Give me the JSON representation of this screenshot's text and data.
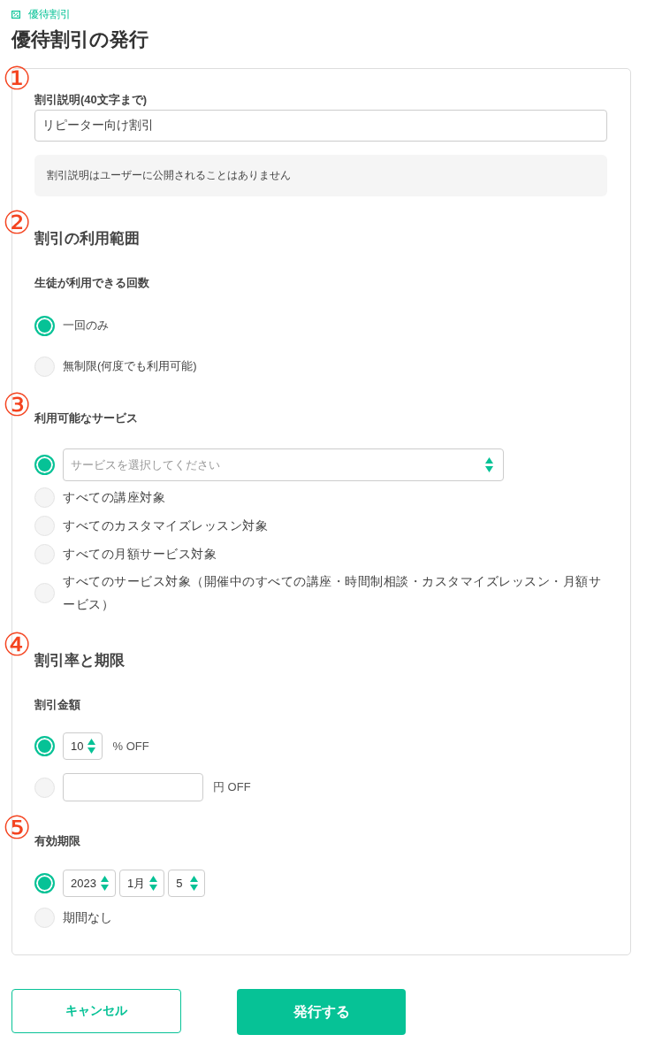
{
  "breadcrumb": {
    "label": "優待割引"
  },
  "title": "優待割引の発行",
  "form": {
    "blocks": [
      {
        "kind": "text_field",
        "marker": "①",
        "label": "割引説明(40文字まで)",
        "value": "リピーター向け割引",
        "note": "割引説明はユーザーに公開されることはありません"
      },
      {
        "kind": "heading",
        "marker": "②",
        "text": "割引の利用範囲"
      },
      {
        "kind": "radio_group",
        "label": "生徒が利用できる回数",
        "options": [
          {
            "kind": "text",
            "label": "一回のみ",
            "selected": true
          },
          {
            "kind": "text",
            "label": "無制限(何度でも利用可能)",
            "selected": false
          }
        ]
      },
      {
        "kind": "radio_group",
        "marker": "③",
        "label": "利用可能なサービス",
        "options": [
          {
            "kind": "select",
            "placeholder": "サービスを選択してください",
            "selected": true
          },
          {
            "kind": "text",
            "label": "すべての講座対象",
            "selected": false
          },
          {
            "kind": "text",
            "label": "すべてのカスタマイズレッスン対象",
            "selected": false
          },
          {
            "kind": "text",
            "label": "すべての月額サービス対象",
            "selected": false
          },
          {
            "kind": "text",
            "label": "すべてのサービス対象（開催中のすべての講座・時間制相談・カスタマイズレッスン・月額サービス）",
            "selected": false
          }
        ]
      },
      {
        "kind": "heading",
        "marker": "④",
        "text": "割引率と期限"
      },
      {
        "kind": "radio_group",
        "label": "割引金額",
        "options": [
          {
            "kind": "spinners",
            "spinners": [
              "10"
            ],
            "unit": "% OFF",
            "selected": true
          },
          {
            "kind": "input",
            "unit": "円 OFF",
            "selected": false
          }
        ]
      },
      {
        "kind": "radio_group",
        "marker": "⑤",
        "label": "有効期限",
        "options": [
          {
            "kind": "spinners",
            "spinners": [
              "2023",
              "1月",
              "5"
            ],
            "selected": true
          },
          {
            "kind": "text",
            "label": "期間なし",
            "selected": false
          }
        ]
      }
    ]
  },
  "buttons": [
    {
      "kind": "secondary",
      "label": "キャンセル"
    },
    {
      "kind": "primary",
      "label": "発行する"
    }
  ]
}
